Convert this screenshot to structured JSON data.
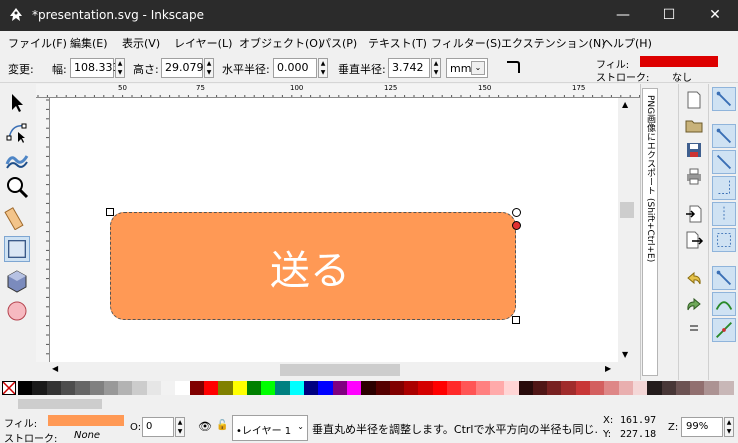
{
  "window": {
    "title": "*presentation.svg - Inkscape",
    "minimize_glyph": "—",
    "maximize_glyph": "☐",
    "close_glyph": "✕"
  },
  "menubar": [
    {
      "id": "file",
      "label": "ファイル(F)"
    },
    {
      "id": "edit",
      "label": "編集(E)"
    },
    {
      "id": "view",
      "label": "表示(V)"
    },
    {
      "id": "layer",
      "label": "レイヤー(L)"
    },
    {
      "id": "object",
      "label": "オブジェクト(O)"
    },
    {
      "id": "path",
      "label": "パス(P)"
    },
    {
      "id": "text",
      "label": "テキスト(T)"
    },
    {
      "id": "filters",
      "label": "フィルター(S)"
    },
    {
      "id": "extensions",
      "label": "エクステンション(N)"
    },
    {
      "id": "help",
      "label": "ヘルプ(H)"
    }
  ],
  "toolcontrols": {
    "change_label": "変更:",
    "width_label": "幅:",
    "width_value": "108.333",
    "height_label": "高さ:",
    "height_value": "29.079",
    "rx_label": "水平半径:",
    "rx_value": "0.000",
    "ry_label": "垂直半径:",
    "ry_value": "3.742",
    "unit": "mm"
  },
  "fillstroke_top": {
    "fill_label": "フィル:",
    "stroke_label": "ストローク:",
    "stroke_value": "なし",
    "fill_color": "#dd0000"
  },
  "tools": [
    {
      "name": "selector-tool-icon",
      "active": false
    },
    {
      "name": "node-tool-icon",
      "active": false
    },
    {
      "name": "tweak-tool-icon",
      "active": false
    },
    {
      "name": "zoom-tool-icon",
      "active": false
    },
    {
      "name": "measure-tool-icon",
      "active": false
    },
    {
      "name": "rectangle-tool-icon",
      "active": true
    },
    {
      "name": "3dbox-tool-icon",
      "active": false
    },
    {
      "name": "ellipse-tool-icon",
      "active": false
    }
  ],
  "ruler": {
    "h_labels": [
      "50",
      "75",
      "100",
      "125",
      "150",
      "175"
    ],
    "v_labels": [
      "5",
      "1",
      "5",
      "5",
      "2"
    ]
  },
  "canvas": {
    "button_text": "送る",
    "button_color": "#ff9955",
    "text_color": "#ffffff"
  },
  "dock": {
    "tab_text": "PNG画像にエクスポート (Shift+Ctrl+E)"
  },
  "palette": {
    "colors": [
      "#000000",
      "#1a1a1a",
      "#333333",
      "#4d4d4d",
      "#666666",
      "#808080",
      "#999999",
      "#b3b3b3",
      "#cccccc",
      "#e6e6e6",
      "#f2f2f2",
      "#ffffff",
      "#800000",
      "#ff0000",
      "#808000",
      "#ffff00",
      "#008000",
      "#00ff00",
      "#008080",
      "#00ffff",
      "#000080",
      "#0000ff",
      "#800080",
      "#ff00ff",
      "#2b0000",
      "#550000",
      "#800000",
      "#aa0000",
      "#d40000",
      "#ff0000",
      "#ff2a2a",
      "#ff5555",
      "#ff8080",
      "#ffaaaa",
      "#ffd5d5",
      "#280b0b",
      "#501616",
      "#782121",
      "#a02c2c",
      "#c83737",
      "#d35f5f",
      "#de8787",
      "#e9afaf",
      "#f4d7d7",
      "#241c1c",
      "#483737",
      "#6c5353",
      "#916f6f",
      "#ac9393",
      "#c8b7b7"
    ]
  },
  "statusbar": {
    "fill_label": "フィル:",
    "stroke_label": "ストローク:",
    "stroke_value": "None",
    "fill_color": "#ff9955",
    "opacity_label": "O:",
    "opacity_value": "0",
    "layer_value": "•レイヤー 1",
    "message": "垂直丸め半径を調整します。Ctrlで水平方向の半径も同じ...",
    "x_label": "X:",
    "x_value": "161.97",
    "y_label": "Y:",
    "y_value": "227.18",
    "zoom_label": "Z:",
    "zoom_value": "99%"
  }
}
